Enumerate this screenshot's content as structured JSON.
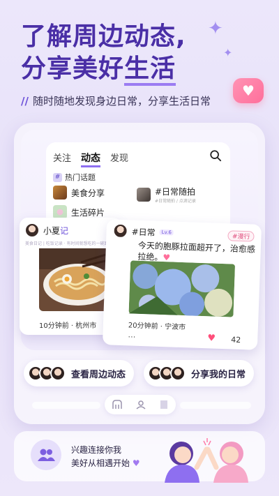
{
  "headline": {
    "line1": "了解周边动态,",
    "line2_part1": "分享美好",
    "line2_part2": "生活"
  },
  "subtitle": "随时随地发现身边日常，分享生活日常",
  "subtitle_mark": "//",
  "app": {
    "tabs": [
      "关注",
      "动态",
      "发现"
    ],
    "hot_title": "热门话题",
    "topics": [
      {
        "label": "美食分享"
      },
      {
        "label": "#日常随拍",
        "sublabel": "#日常随拍 / 点滴记录"
      },
      {
        "label": "生活碎片"
      }
    ]
  },
  "card_left": {
    "name": "小夏",
    "name_accent": "记",
    "desc": "美食日记 | 吃饭记录 · 有时间就想吃的一碗面",
    "time_loc": "10分钟前 · 杭州市"
  },
  "card_right": {
    "name": "#日常",
    "level": "Lv.6",
    "tag": "#漫行",
    "text": "今天的胞豚拉面超开了，治愈感拉绝。",
    "text_accent": "♥",
    "time_loc": "20分钟前 · 宁波市",
    "likes": "42",
    "more": "…"
  },
  "buttons": {
    "nearby": "查看周边动态",
    "share": "分享我的日常"
  },
  "invite": {
    "line1": "兴趣连接你我",
    "line2": "美好从相遇开始"
  },
  "colors": {
    "brand": "#4a2fa6",
    "accent": "#8e6ff0",
    "pink": "#ff6f9b"
  }
}
